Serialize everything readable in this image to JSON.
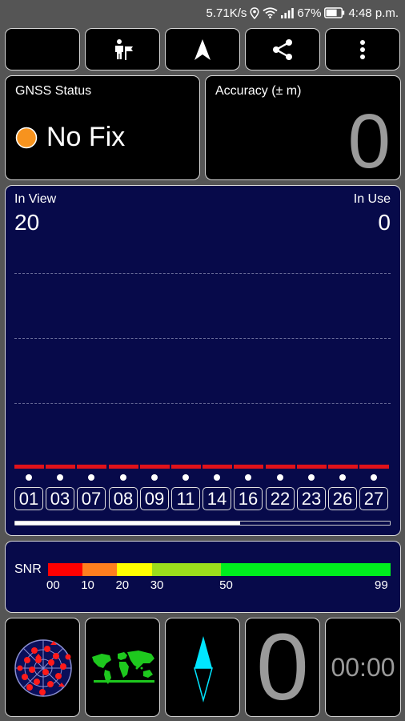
{
  "status_bar": {
    "speed": "5.71K/s",
    "battery": "67%",
    "time": "4:48 p.m.",
    "icons": [
      "location-icon",
      "wifi-icon",
      "signal-icon",
      "battery-icon"
    ]
  },
  "toolbar": {
    "buttons": [
      {
        "icon": "moon-icon"
      },
      {
        "icon": "flag-person-icon"
      },
      {
        "icon": "navigation-arrow-icon"
      },
      {
        "icon": "share-icon"
      },
      {
        "icon": "more-vertical-icon"
      }
    ]
  },
  "gnss_status": {
    "title": "GNSS Status",
    "fix_text": "No Fix",
    "fix_color": "#f7931e"
  },
  "accuracy": {
    "title": "Accuracy (± m)",
    "value": "0"
  },
  "signal": {
    "in_view_label": "In View",
    "in_view_value": "20",
    "in_use_label": "In Use",
    "in_use_value": "0",
    "satellites": [
      "01",
      "03",
      "07",
      "08",
      "09",
      "11",
      "14",
      "16",
      "22",
      "23",
      "26",
      "27"
    ],
    "scroll_fraction": 0.6
  },
  "snr": {
    "label": "SNR",
    "ticks": [
      "00",
      "10",
      "20",
      "30",
      "50",
      "99"
    ],
    "colors": [
      "#ff0000",
      "#ff7f1e",
      "#ffff00",
      "#9cde1c",
      "#00ee1e"
    ]
  },
  "bottom": {
    "speed_value": "0",
    "timer": "00:00",
    "icons": [
      "sky-plot-icon",
      "world-map-icon",
      "compass-icon"
    ]
  },
  "colors": {
    "panel_navy": "#070a4a",
    "background": "#555555",
    "compass_cyan": "#00e5ff"
  }
}
